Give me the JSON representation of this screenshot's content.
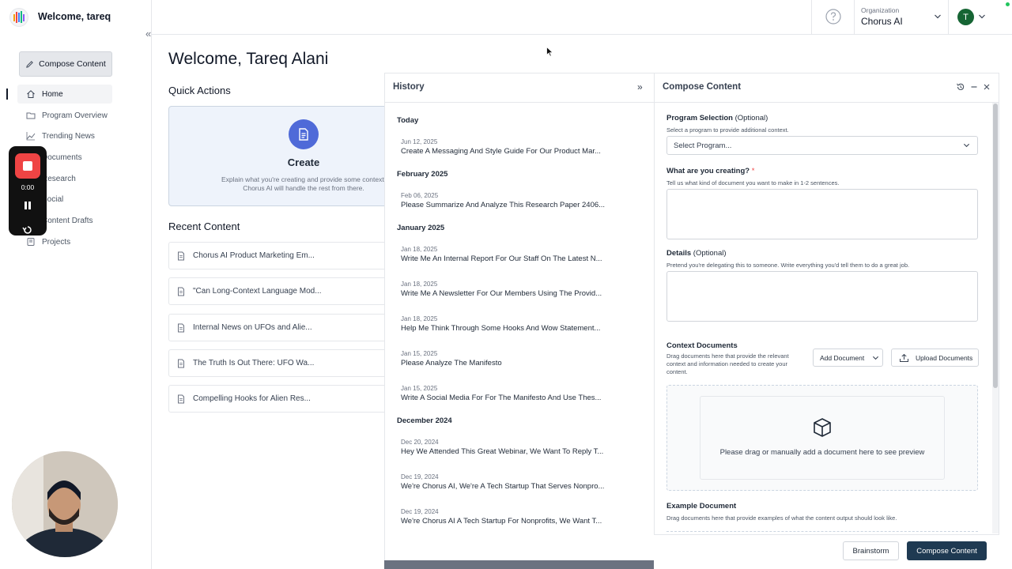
{
  "sidebar": {
    "welcome": "Welcome, tareq",
    "collapse_icon": "«",
    "compose_label": "Compose Content",
    "items": [
      {
        "label": "Home",
        "icon": "home-icon"
      },
      {
        "label": "Program Overview",
        "icon": "folder-icon"
      },
      {
        "label": "Trending News",
        "icon": "trend-icon"
      },
      {
        "label": "Documents",
        "icon": "document-icon"
      },
      {
        "label": "Research",
        "icon": "search-icon"
      },
      {
        "label": "Social",
        "icon": "social-icon"
      },
      {
        "label": "Content Drafts",
        "icon": "drafts-icon"
      },
      {
        "label": "Projects",
        "icon": "projects-icon"
      }
    ]
  },
  "recorder": {
    "time": "0:00"
  },
  "topbar": {
    "org_label": "Organization",
    "org_name": "Chorus AI",
    "avatar_initial": "T"
  },
  "main": {
    "title": "Welcome, Tareq Alani",
    "quick_actions_title": "Quick Actions",
    "create_title": "Create",
    "create_desc": "Explain what you're creating and provide some context. Chorus AI will handle the rest from there.",
    "recent_title": "Recent Content",
    "recent": [
      "Chorus AI Product Marketing Em...",
      "\"Can Long-Context Language Mod...",
      "Internal News on UFOs and Alie...",
      "The Truth Is Out There: UFO Wa...",
      "Compelling Hooks for Alien Res..."
    ]
  },
  "history": {
    "title": "History",
    "expand_icon": "»",
    "groups": [
      {
        "label": "Today",
        "items": [
          {
            "date": "Jun 12, 2025",
            "text": "Create A Messaging And Style Guide For Our Product Mar..."
          }
        ]
      },
      {
        "label": "February 2025",
        "items": [
          {
            "date": "Feb 06, 2025",
            "text": "Please Summarize And Analyze This Research Paper 2406..."
          }
        ]
      },
      {
        "label": "January 2025",
        "items": [
          {
            "date": "Jan 18, 2025",
            "text": "Write Me An Internal Report For Our Staff On The Latest N..."
          },
          {
            "date": "Jan 18, 2025",
            "text": "Write Me A Newsletter For Our Members Using The Provid..."
          },
          {
            "date": "Jan 18, 2025",
            "text": "Help Me Think Through Some Hooks And Wow Statement..."
          },
          {
            "date": "Jan 15, 2025",
            "text": "Please Analyze The Manifesto"
          },
          {
            "date": "Jan 15, 2025",
            "text": "Write A Social Media For For The Manifesto And Use Thes..."
          }
        ]
      },
      {
        "label": "December 2024",
        "items": [
          {
            "date": "Dec 20, 2024",
            "text": "Hey We Attended This Great Webinar, We Want To Reply T..."
          },
          {
            "date": "Dec 19, 2024",
            "text": "We're Chorus AI, We're A Tech Startup That Serves Nonpro..."
          },
          {
            "date": "Dec 19, 2024",
            "text": "We're Chorus AI A Tech Startup For Nonprofits, We Want T..."
          }
        ]
      }
    ]
  },
  "compose": {
    "title": "Compose Content",
    "program_label": "Program Selection",
    "program_optional": "(Optional)",
    "program_help": "Select a program to provide additional context.",
    "program_placeholder": "Select Program...",
    "creating_label": "What are you creating?",
    "creating_required": "*",
    "creating_help": "Tell us what kind of document you want to make in 1-2 sentences.",
    "details_label": "Details",
    "details_optional": "(Optional)",
    "details_help": "Pretend you're delegating this to someone. Write everything you'd tell them to do a great job.",
    "context_label": "Context Documents",
    "context_help": "Drag documents here that provide the relevant context and information needed to create your content.",
    "add_document": "Add Document",
    "upload_documents": "Upload Documents",
    "drop_text": "Please drag or manually add a document here to see preview",
    "example_label": "Example Document",
    "example_help": "Drag documents here that provide examples of what the content output should look like.",
    "brainstorm": "Brainstorm",
    "submit": "Compose Content"
  }
}
